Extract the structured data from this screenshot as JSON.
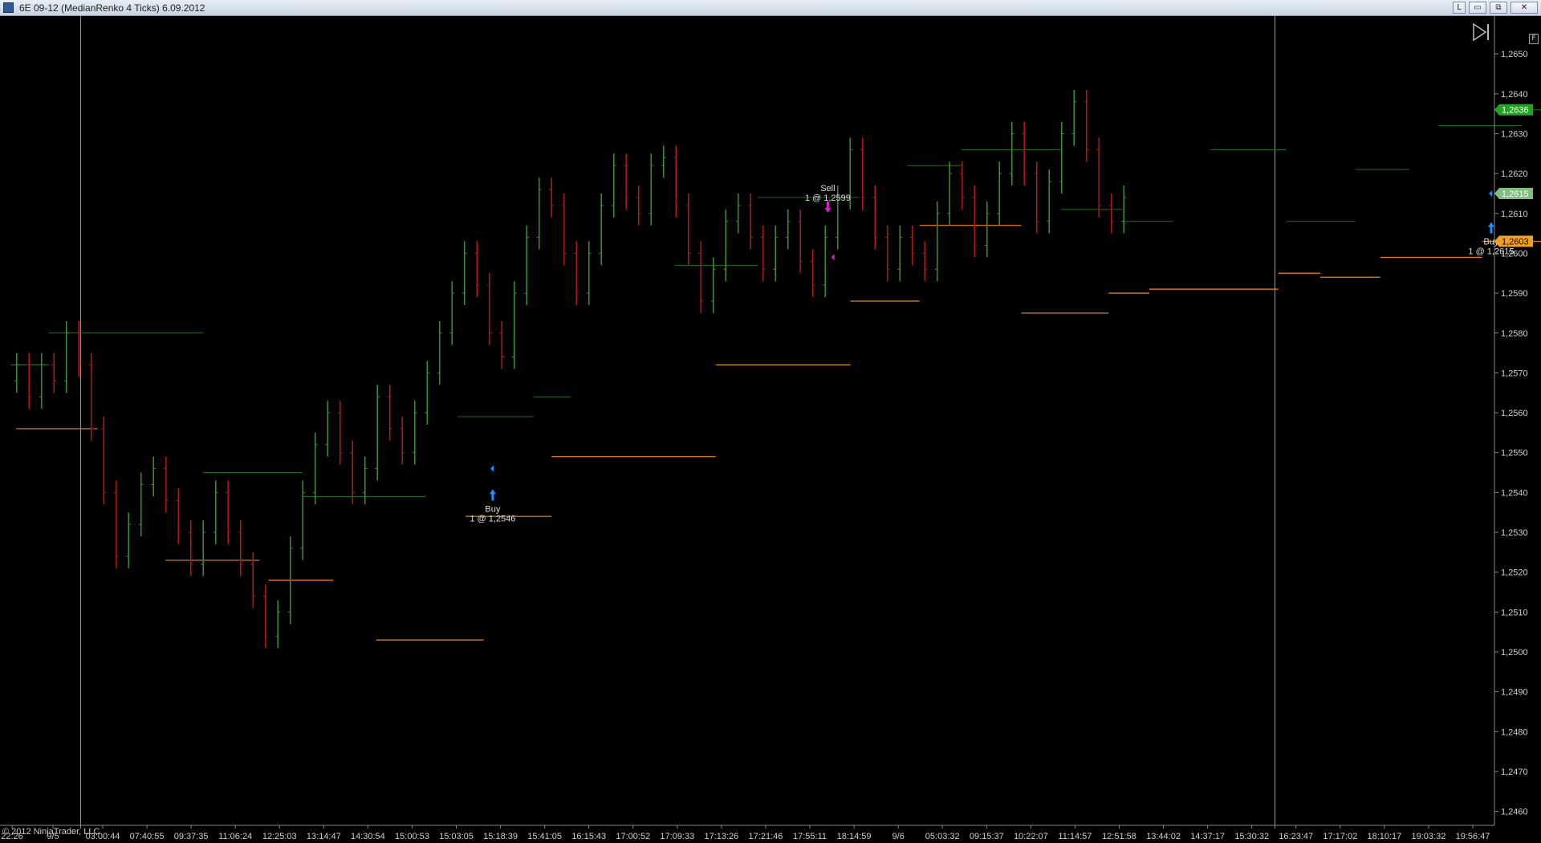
{
  "window": {
    "title": "6E 09-12 (MedianRenko 4 Ticks)  6.09.2012",
    "buttons": {
      "link": "L",
      "minimize": "▭",
      "maximize": "⧉",
      "close": "✕"
    },
    "f_label": "F"
  },
  "copyright": "© 2012 NinjaTrader, LLC",
  "icons": {
    "scroll_end": "play-to-end-icon",
    "app": "chart-app-icon"
  },
  "colors": {
    "background": "#000000",
    "up_bar": "#3a8a3a",
    "down_bar": "#b01818",
    "resistance_line": "#1e6e1e",
    "support_line": "#f08a10",
    "axis_text": "#cfcfcf",
    "session_line": "#9a9a9a",
    "buy_arrow": "#1e90ff",
    "sell_arrow": "#e020c8",
    "price_tag_last": "#22a322",
    "price_tag_mid": "#7fbf7f",
    "price_tag_order": "#f0a020"
  },
  "chart_data": {
    "type": "bar",
    "bar_type": "MedianRenko 4 Ticks",
    "y_ticks": [
      "1,2460",
      "1,2470",
      "1,2480",
      "1,2490",
      "1,2500",
      "1,2510",
      "1,2520",
      "1,2530",
      "1,2540",
      "1,2550",
      "1,2560",
      "1,2570",
      "1,2580",
      "1,2590",
      "1,2600",
      "1,2610",
      "1,2620",
      "1,2630",
      "1,2640",
      "1,2650"
    ],
    "ylim": [
      1.24565,
      1.26595
    ],
    "x_ticks": [
      "22:26",
      "9/5",
      "03:00:44",
      "07:40:55",
      "09:37:35",
      "11:06:24",
      "12:25:03",
      "13:14:47",
      "14:30:54",
      "15:00:53",
      "15:03:05",
      "15:18:39",
      "15:41:05",
      "16:15:43",
      "17:00:52",
      "17:09:33",
      "17:13:26",
      "17:21:46",
      "17:55:11",
      "18:14:59",
      "9/6",
      "05:03:32",
      "09:15:37",
      "10:22:07",
      "11:14:57",
      "12:51:58",
      "13:44:02",
      "14:37:17",
      "15:30:32",
      "16:23:47",
      "17:17:02",
      "18:10:17",
      "19:03:32",
      "19:56:47"
    ],
    "path": [
      1.2568,
      1.2572,
      1.2564,
      1.2572,
      1.2568,
      1.258,
      1.2572,
      1.2556,
      1.254,
      1.2524,
      1.2532,
      1.2542,
      1.2546,
      1.2538,
      1.253,
      1.2522,
      1.253,
      1.254,
      1.253,
      1.2522,
      1.2514,
      1.2504,
      1.251,
      1.2526,
      1.254,
      1.2552,
      1.256,
      1.255,
      1.254,
      1.2546,
      1.2564,
      1.2556,
      1.255,
      1.256,
      1.257,
      1.258,
      1.259,
      1.26,
      1.2592,
      1.258,
      1.2574,
      1.259,
      1.2604,
      1.2616,
      1.2612,
      1.26,
      1.259,
      1.26,
      1.2612,
      1.2622,
      1.2614,
      1.261,
      1.2622,
      1.2624,
      1.2612,
      1.26,
      1.2588,
      1.2596,
      1.2608,
      1.2612,
      1.2604,
      1.2596,
      1.2604,
      1.2608,
      1.2598,
      1.2592,
      1.2604,
      1.2614,
      1.2626,
      1.2614,
      1.2604,
      1.2596,
      1.2604,
      1.26,
      1.2596,
      1.261,
      1.262,
      1.2614,
      1.2602,
      1.261,
      1.262,
      1.263,
      1.262,
      1.2608,
      1.2618,
      1.263,
      1.2638,
      1.2626,
      1.2612,
      1.2608,
      1.2614
    ],
    "resistance_levels": [
      {
        "from": 0.0,
        "to": 0.034,
        "price": 1.2572
      },
      {
        "from": 0.034,
        "to": 0.17,
        "price": 1.258
      },
      {
        "from": 0.17,
        "to": 0.258,
        "price": 1.2545
      },
      {
        "from": 0.258,
        "to": 0.367,
        "price": 1.2539
      },
      {
        "from": 0.395,
        "to": 0.462,
        "price": 1.2559
      },
      {
        "from": 0.462,
        "to": 0.495,
        "price": 1.2564
      },
      {
        "from": 0.587,
        "to": 0.66,
        "price": 1.2597
      },
      {
        "from": 0.66,
        "to": 0.75,
        "price": 1.2614
      },
      {
        "from": 0.792,
        "to": 0.84,
        "price": 1.2622
      },
      {
        "from": 0.84,
        "to": 0.928,
        "price": 1.2626
      },
      {
        "from": 0.928,
        "to": 0.982,
        "price": 1.2611
      },
      {
        "from": 0.982,
        "to": 1.027,
        "price": 1.2608
      },
      {
        "from": 1.06,
        "to": 1.127,
        "price": 1.2626
      },
      {
        "from": 1.127,
        "to": 1.188,
        "price": 1.2608
      },
      {
        "from": 1.188,
        "to": 1.236,
        "price": 1.2621
      },
      {
        "from": 1.262,
        "to": 1.335,
        "price": 1.2632
      },
      {
        "from": 1.335,
        "to": 1.395,
        "price": 1.2636
      }
    ],
    "support_levels": [
      {
        "from": 0.005,
        "to": 0.077,
        "price": 1.2556
      },
      {
        "from": 0.137,
        "to": 0.22,
        "price": 1.2523
      },
      {
        "from": 0.228,
        "to": 0.285,
        "price": 1.2518
      },
      {
        "from": 0.323,
        "to": 0.418,
        "price": 1.2503
      },
      {
        "from": 0.402,
        "to": 0.478,
        "price": 1.2534
      },
      {
        "from": 0.478,
        "to": 0.623,
        "price": 1.2549
      },
      {
        "from": 0.623,
        "to": 0.742,
        "price": 1.2572
      },
      {
        "from": 0.742,
        "to": 0.803,
        "price": 1.2588
      },
      {
        "from": 0.803,
        "to": 0.893,
        "price": 1.2607
      },
      {
        "from": 0.893,
        "to": 0.97,
        "price": 1.2585
      },
      {
        "from": 0.97,
        "to": 1.006,
        "price": 1.259
      },
      {
        "from": 1.006,
        "to": 1.12,
        "price": 1.2591
      },
      {
        "from": 1.12,
        "to": 1.157,
        "price": 1.2595
      },
      {
        "from": 1.157,
        "to": 1.21,
        "price": 1.2594
      },
      {
        "from": 1.21,
        "to": 1.3,
        "price": 1.2599
      },
      {
        "from": 1.3,
        "to": 1.395,
        "price": 1.2603
      }
    ],
    "session_breaks": [
      0.062,
      1.117
    ],
    "trades": [
      {
        "side": "Buy",
        "label": "Buy",
        "detail": "1 @ 1,2546",
        "bar": 0.426,
        "price": 1.2539
      },
      {
        "side": "Sell",
        "label": "Sell",
        "detail": "1 @ 1,2599",
        "bar": 0.722,
        "price": 1.2612
      },
      {
        "side": "Buy",
        "label": "Buy",
        "detail": "1 @ 1,2615",
        "bar": 1.308,
        "price": 1.2606
      }
    ],
    "entry_markers": [
      {
        "side": "Buy",
        "bar": 0.424,
        "price": 1.2546
      },
      {
        "side": "Sell",
        "bar": 0.725,
        "price": 1.2599
      },
      {
        "side": "Buy",
        "bar": 1.306,
        "price": 1.2615
      }
    ],
    "price_tags": [
      {
        "label": "1,2636",
        "price": 1.2636,
        "kind": "last"
      },
      {
        "label": "1,2615",
        "price": 1.2615,
        "kind": "mid"
      },
      {
        "label": "1,2603",
        "price": 1.2603,
        "kind": "order"
      }
    ],
    "xlabel": "",
    "ylabel": "",
    "grid": false
  }
}
